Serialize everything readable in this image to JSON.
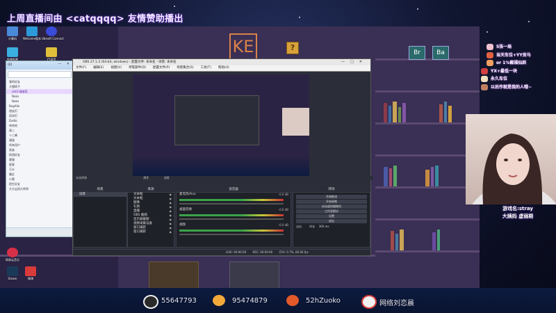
{
  "stream": {
    "title": "上周直播间由 <catqqqq> 友情赞助播出"
  },
  "desktop": {
    "icons": [
      {
        "label": "计算机"
      },
      {
        "label": "WeGame版本"
      },
      {
        "label": "Ubisoft Connect"
      },
      {
        "label": "哔哩哔哩"
      },
      {
        "label": "YY语音"
      },
      {
        "label": "网易云音乐"
      },
      {
        "label": "Steam"
      },
      {
        "label": "微博"
      }
    ],
    "sign_left": "Br",
    "sign_right": "Ba"
  },
  "qq": {
    "header_title": "QQ",
    "contacts": [
      {
        "label": "我的好友",
        "group": true
      },
      {
        "label": "大猪蹄子",
        "group": true
      },
      {
        "label": "sakil 喵喵怪",
        "hl": true
      },
      {
        "label": "Nako"
      },
      {
        "label": "Nako"
      },
      {
        "label": "BugAlle",
        "group": true
      },
      {
        "label": "朋友们",
        "group": true
      },
      {
        "label": "同学们",
        "group": true
      },
      {
        "label": "Dodlo",
        "group": true
      },
      {
        "label": "哈哈哈",
        "group": true
      },
      {
        "label": "高三",
        "group": true
      },
      {
        "label": "十三酱",
        "group": true
      },
      {
        "label": "通道",
        "group": true
      },
      {
        "label": "所有用户",
        "group": true
      },
      {
        "label": "家族",
        "group": true
      },
      {
        "label": "网游好友",
        "group": true
      },
      {
        "label": "客服",
        "group": true
      },
      {
        "label": "星星",
        "group": true
      },
      {
        "label": "万众",
        "group": true
      },
      {
        "label": "最近",
        "group": true
      },
      {
        "label": "小窝",
        "group": true
      },
      {
        "label": "陌生好友",
        "group": true
      },
      {
        "label": "大大云阳大帅哥",
        "group": true
      }
    ]
  },
  "obs": {
    "window_title": "OBS 27.1.3 (64-bit, windows) - 配置文件: 未命名 - 场景: 未命名",
    "menu": [
      "文件(F)",
      "编辑(E)",
      "视图(V)",
      "停靠部件(D)",
      "配置文件(P)",
      "场景集合(S)",
      "工具(T)",
      "帮助(H)"
    ],
    "context_label": "未选择源",
    "properties_label": "属性",
    "filters_label": "滤镜",
    "docks": {
      "scenes": "场景",
      "sources": "来源",
      "mixer": "混音器",
      "transitions": "转场",
      "controls": "控制"
    },
    "scenes": [
      "场景"
    ],
    "sources": [
      "文本框",
      "文本框",
      "图像",
      "礼物",
      "直播",
      "OBS 截图",
      "显示器截图",
      "视频采集设备",
      "窗口捕获",
      "窗口捕获"
    ],
    "mixer": [
      {
        "label": "麦克风/Aux",
        "db": "-0.0 dB"
      },
      {
        "label": "桌面音频",
        "db": "-0.0 dB"
      },
      {
        "label": "视频",
        "db": "-0.0 dB"
      }
    ],
    "controls": [
      "开始推流",
      "开始录制",
      "启动虚拟摄像机",
      "工作室模式",
      "设置",
      "退出"
    ],
    "transition": {
      "name": "淡出",
      "duration_label": "时长",
      "duration": "300 ms"
    },
    "status": {
      "live": "LIVE: 00:00:00",
      "rec": "REC: 00:00:00",
      "cpu": "CPU: 0.7%, 60.00 fps"
    }
  },
  "overlay": {
    "notes": [
      "5张一局",
      "当天车位+YY贡马",
      "or 1%截福仙跃",
      "YX+最低一块",
      "永久车位",
      "以后作就是我的人哦~"
    ],
    "game_name": "游戏名:stray",
    "tags": "大姨妈  虚弱期"
  },
  "bottom": {
    "items": [
      {
        "type": "qq",
        "value": "55647793"
      },
      {
        "type": "qq-group",
        "value": "95474879"
      },
      {
        "type": "weibo",
        "value": "52hZuoko"
      },
      {
        "type": "weibo",
        "value": "网络刘恋晨"
      }
    ]
  },
  "colors": {
    "accent": "#b050ff",
    "obs_bg": "#2b2e38",
    "meter_green": "#3aa34a"
  }
}
